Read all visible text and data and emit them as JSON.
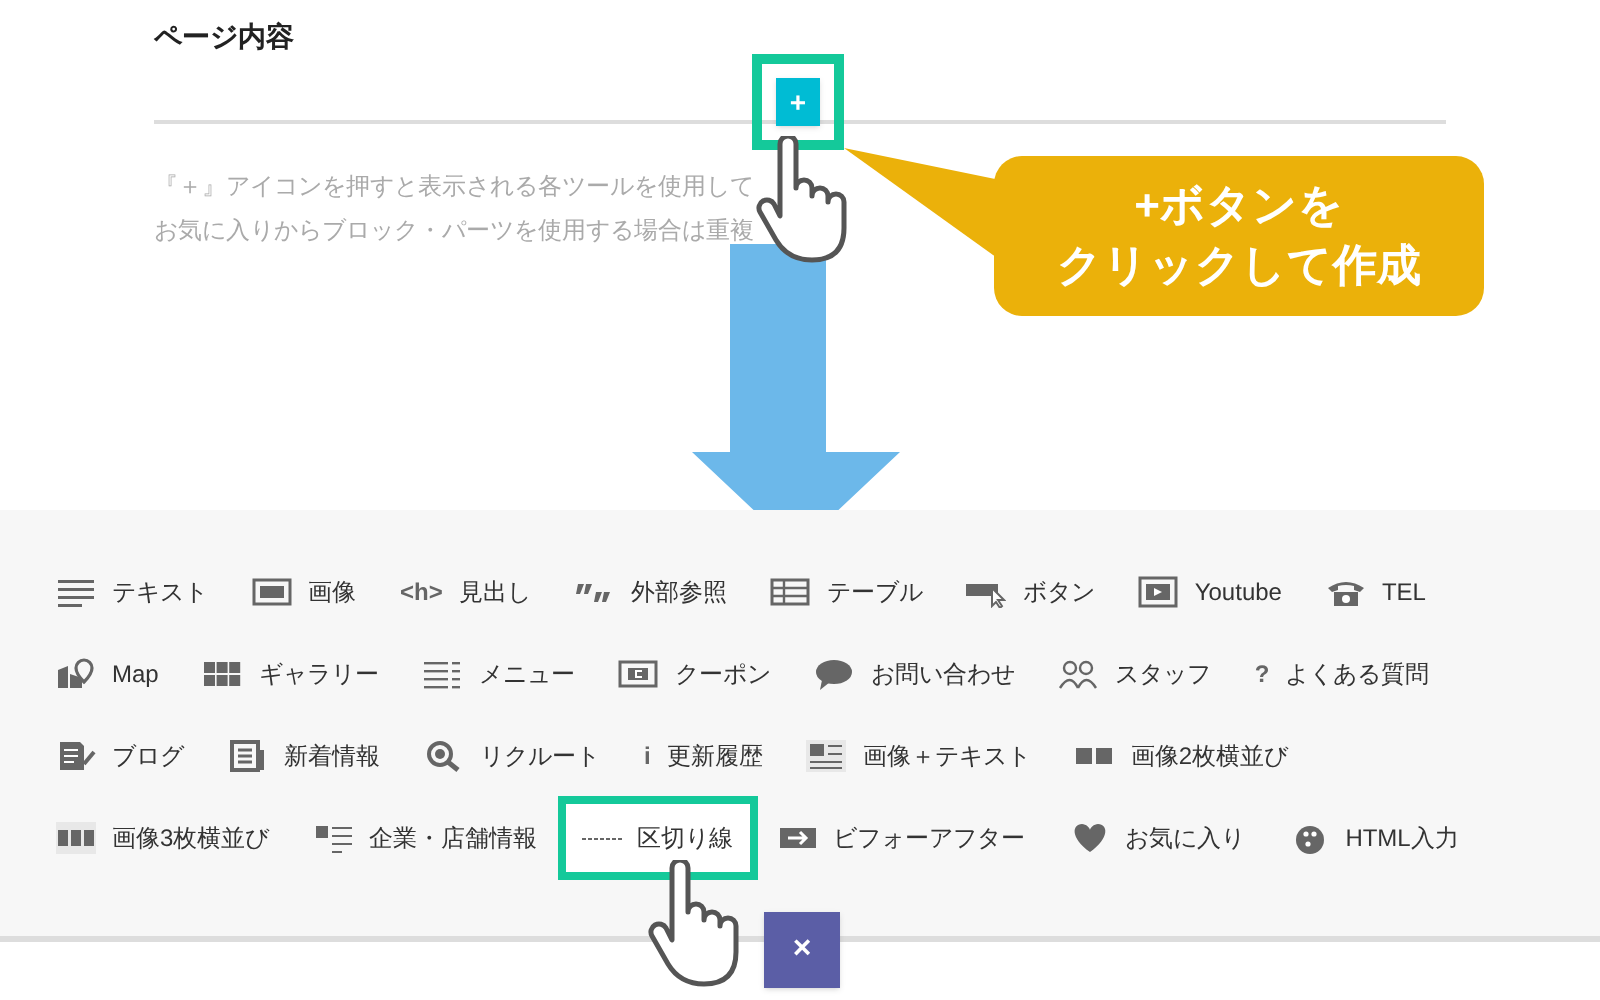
{
  "section_title": "ページ内容",
  "add_button": {
    "label": "+",
    "highlighted": true
  },
  "description": [
    "『＋』アイコンを押すと表示される各ツールを使用して",
    "お気に入りからブロック・パーツを使用する場合は重複"
  ],
  "callout": {
    "lines": [
      "+ボタンを",
      "クリックして作成"
    ]
  },
  "tool_rows": [
    [
      {
        "kind": "lines",
        "label": "テキスト",
        "highlighted": false
      },
      {
        "kind": "image",
        "label": "画像",
        "highlighted": false
      },
      {
        "kind": "glyph",
        "glyph": "<h>",
        "label": "見出し",
        "highlighted": false
      },
      {
        "kind": "quote",
        "label": "外部参照",
        "highlighted": false
      },
      {
        "kind": "table",
        "label": "テーブル",
        "highlighted": false
      },
      {
        "kind": "button",
        "label": "ボタン",
        "highlighted": false
      },
      {
        "kind": "video",
        "label": "Youtube",
        "highlighted": false
      },
      {
        "kind": "phone",
        "label": "TEL",
        "highlighted": false
      }
    ],
    [
      {
        "kind": "map",
        "label": "Map",
        "highlighted": false
      },
      {
        "kind": "grid",
        "label": "ギャラリー",
        "highlighted": false
      },
      {
        "kind": "menu",
        "label": "メニュー",
        "highlighted": false
      },
      {
        "kind": "coupon",
        "label": "クーポン",
        "highlighted": false
      },
      {
        "kind": "bubble",
        "label": "お問い合わせ",
        "highlighted": false
      },
      {
        "kind": "people",
        "label": "スタッフ",
        "highlighted": false
      },
      {
        "kind": "glyph",
        "glyph": "?",
        "label": "よくある質問",
        "highlighted": false
      }
    ],
    [
      {
        "kind": "blog",
        "label": "ブログ",
        "highlighted": false
      },
      {
        "kind": "news",
        "label": "新着情報",
        "highlighted": false
      },
      {
        "kind": "search",
        "label": "リクルート",
        "highlighted": false
      },
      {
        "kind": "glyph",
        "glyph": "i",
        "label": "更新履歴",
        "highlighted": false
      },
      {
        "kind": "imagetext",
        "label": "画像＋テキスト",
        "highlighted": false
      },
      {
        "kind": "two",
        "label": "画像2枚横並び",
        "highlighted": false
      }
    ],
    [
      {
        "kind": "three",
        "label": "画像3枚横並び",
        "highlighted": false
      },
      {
        "kind": "company",
        "label": "企業・店舗情報",
        "highlighted": false
      },
      {
        "kind": "divider",
        "label": "区切り線",
        "highlighted": true
      },
      {
        "kind": "beforeafter",
        "label": "ビフォーアフター",
        "highlighted": false
      },
      {
        "kind": "heart",
        "label": "お気に入り",
        "highlighted": false
      },
      {
        "kind": "html",
        "label": "HTML入力",
        "highlighted": false
      }
    ]
  ],
  "close_button": {
    "label": "×"
  }
}
